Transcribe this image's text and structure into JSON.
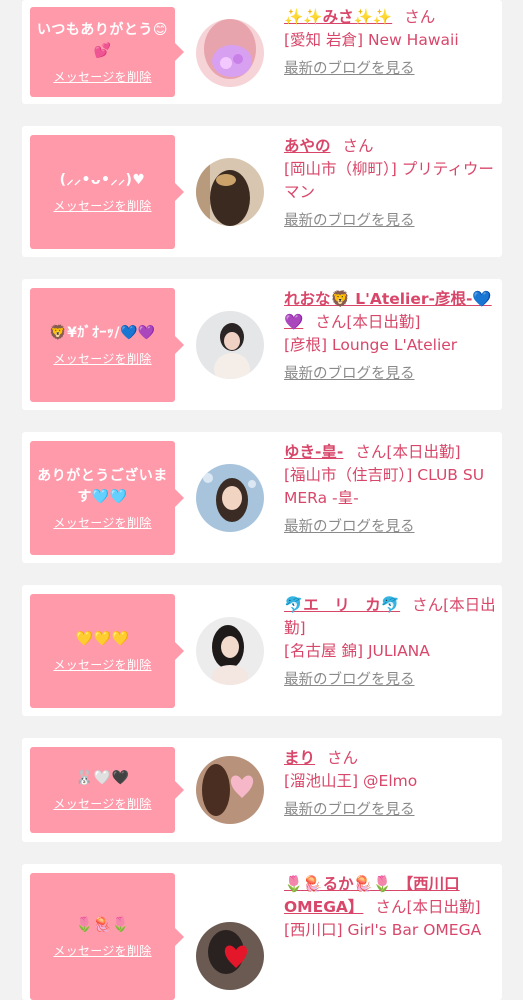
{
  "delete_label": "メッセージを削除",
  "blog_label": "最新のブログを見る",
  "honorific": "さん",
  "colors": {
    "bubble": "#ff9aab",
    "accent": "#d8476a",
    "link_gray": "#8a8a8a",
    "background": "#f2f2f2"
  },
  "cards": [
    {
      "message": "いつもありがとう😊💕",
      "name": "✨✨みさ✨✨",
      "status": "",
      "shop": "[愛知 岩倉] New Hawaii",
      "avatar_icon": "profile-photo"
    },
    {
      "message": "(⸝⸝•ᴗ•⸝⸝)♥",
      "name": "あやの",
      "status": "",
      "shop": "[岡山市（柳町）] プリティウーマン",
      "avatar_icon": "profile-photo"
    },
    {
      "message": "🦁¥ｶﾞｵｰｯ/💙💜",
      "name": "れおな🦁 L'Atelier-彦根-💙💜",
      "status": "[本日出勤]",
      "shop": "[彦根] Lounge L'Atelier",
      "avatar_icon": "profile-photo"
    },
    {
      "message": "ありがとうございます🩵🩵",
      "name": "ゆき-皇-",
      "status": "[本日出勤]",
      "shop": "[福山市（住吉町）] CLUB SUMERa -皇-",
      "avatar_icon": "profile-photo"
    },
    {
      "message": "💛💛💛",
      "name": "🐬エ　リ　カ🐬",
      "status": "[本日出勤]",
      "shop": "[名古屋 錦] JULIANA",
      "avatar_icon": "profile-photo"
    },
    {
      "message": "🐰🤍🖤",
      "name": "まり",
      "status": "",
      "shop": "[溜池山王] @Elmo",
      "avatar_icon": "profile-photo"
    },
    {
      "message": "🌷🪼🌷",
      "name": "🌷🪼るか🪼🌷 【西川口OMEGA】",
      "status": "[本日出勤]",
      "shop": "[西川口] Girl's Bar OMEGA",
      "avatar_icon": "profile-photo"
    }
  ]
}
